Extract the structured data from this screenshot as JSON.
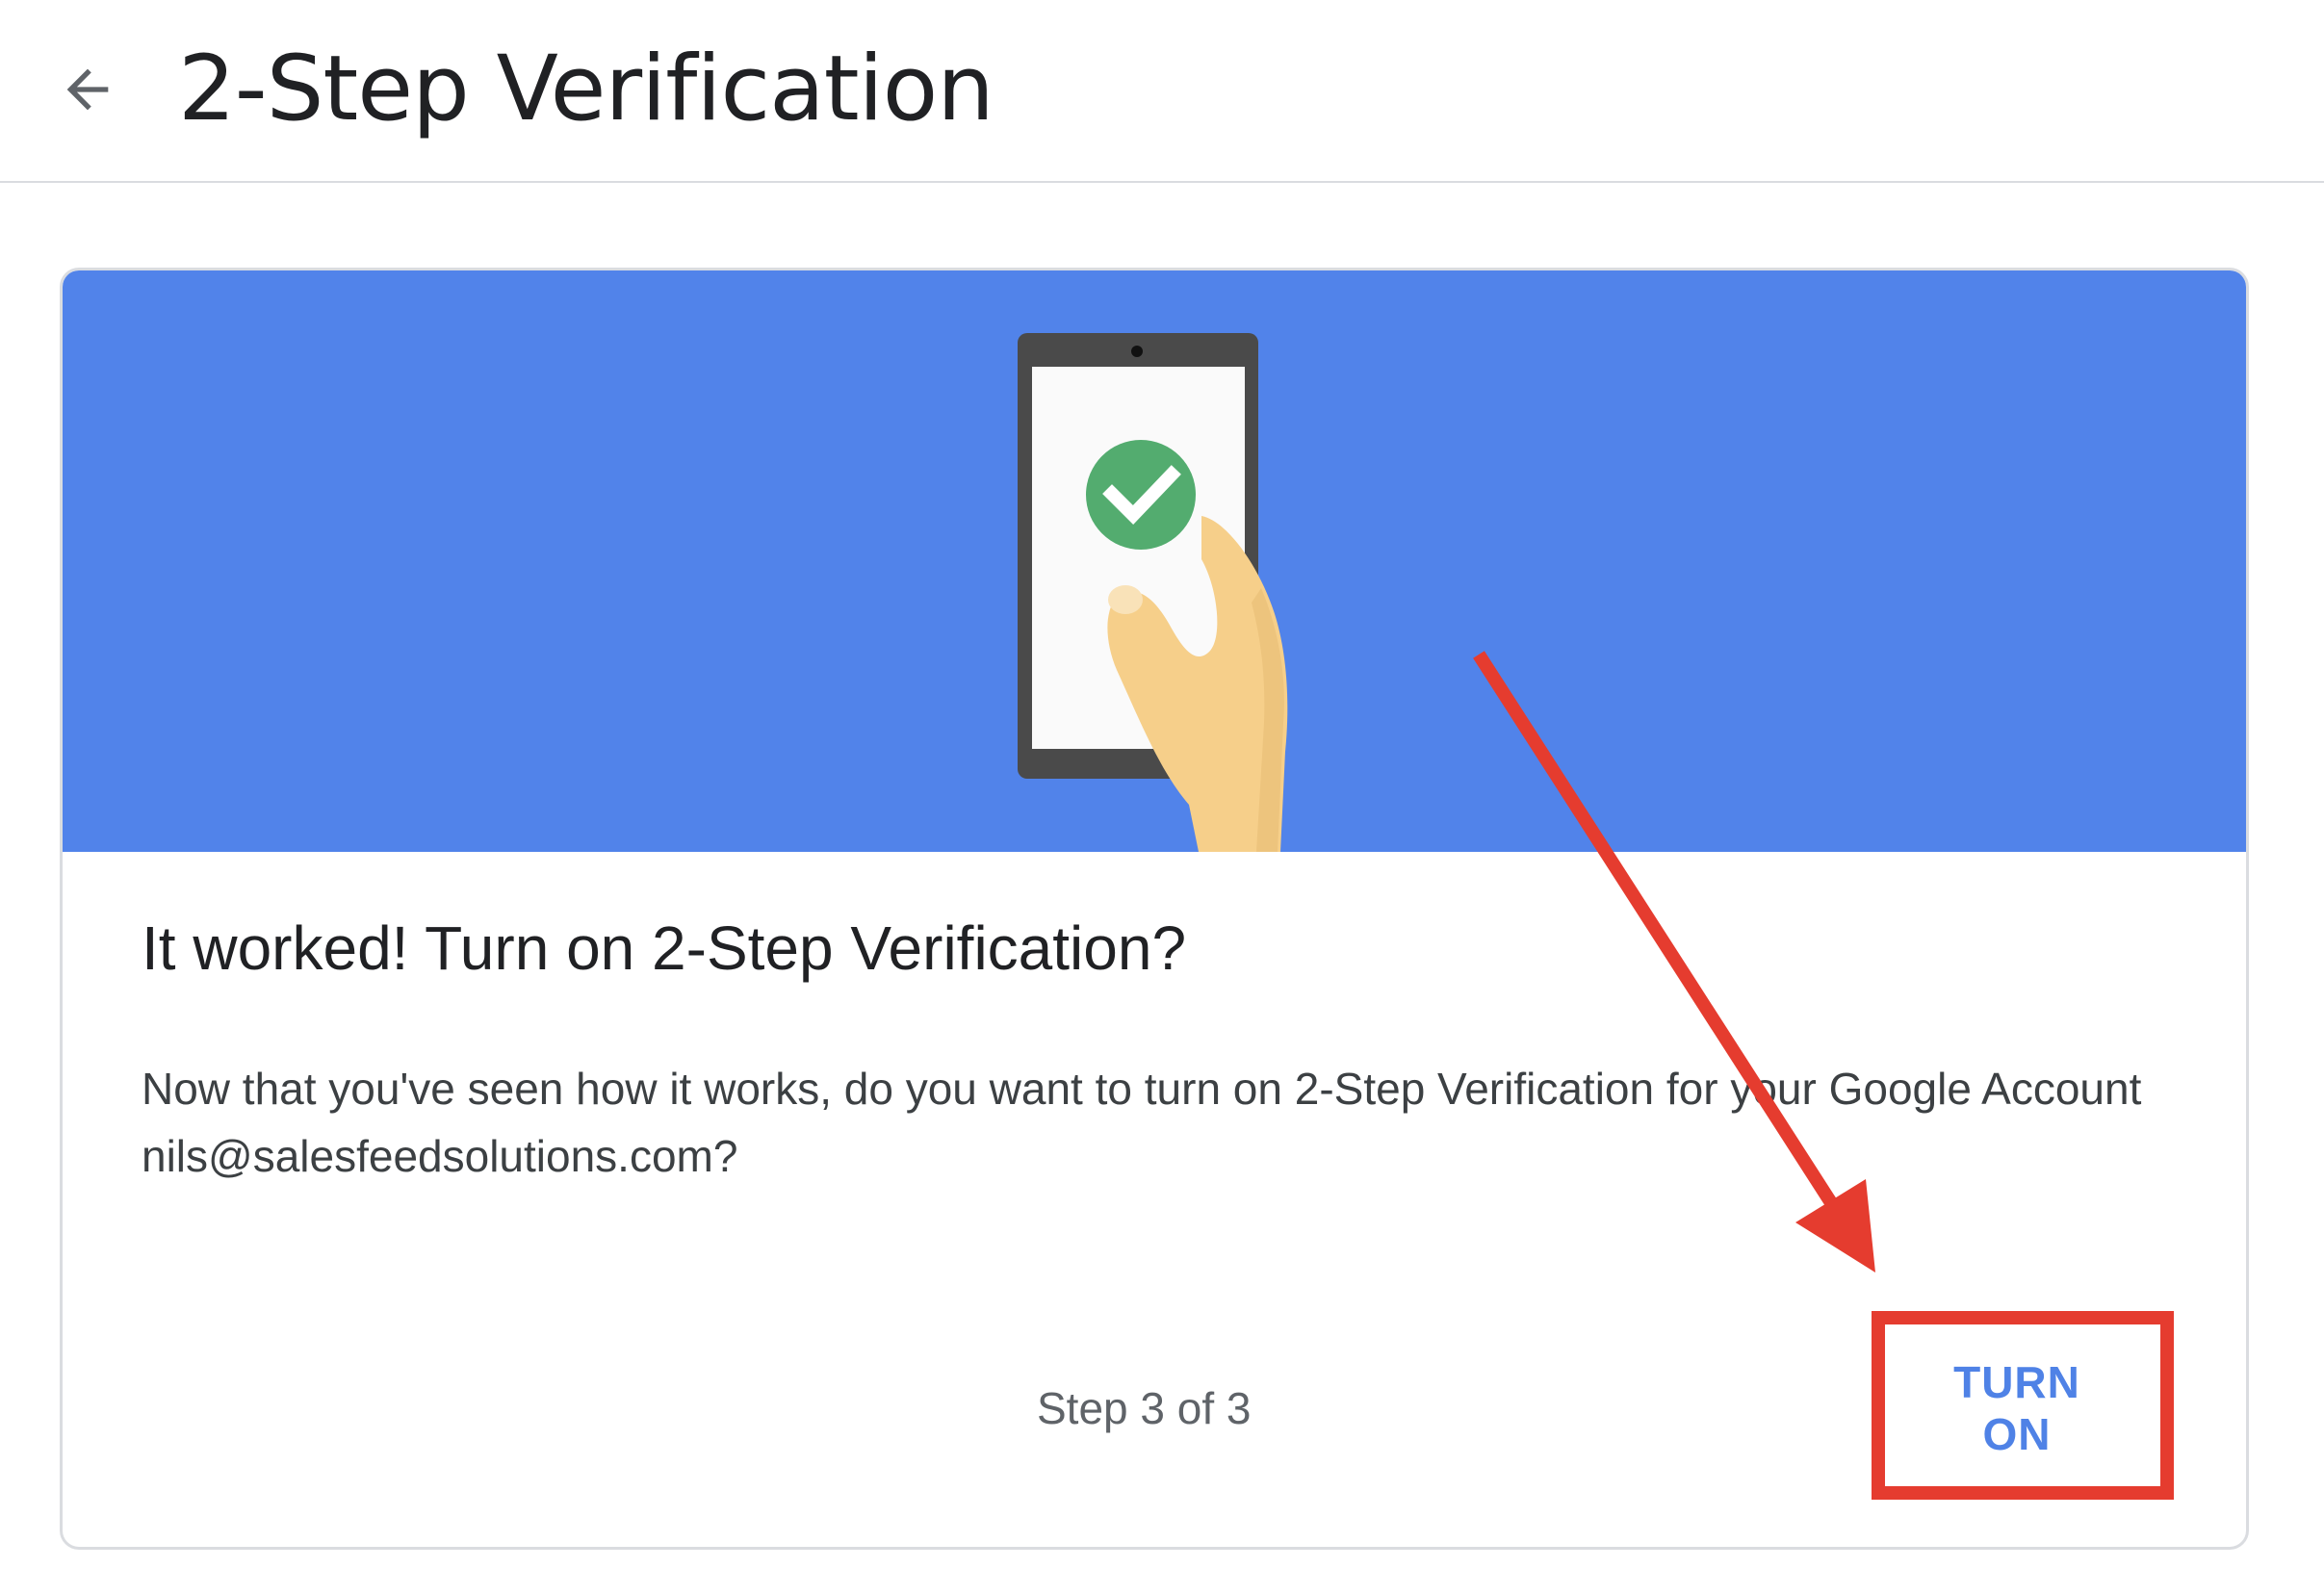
{
  "header": {
    "back_icon": "arrow-back-icon",
    "title": "2-Step Verification"
  },
  "card": {
    "illustration": {
      "description_icon": "phone-check-illustration",
      "background_color": "#5183ea",
      "check_color": "#53ac6f"
    },
    "heading": "It worked! Turn on 2-Step Verification?",
    "body": "Now that you've seen how it works, do you want to turn on 2-Step Verification for your Google Account nils@salesfeedsolutions.com?",
    "step_indicator": "Step 3 of 3",
    "turn_on_label": "TURN ON",
    "accent_color": "#4f82e6"
  },
  "annotation": {
    "color": "#e53c2f",
    "arrow_icon": "red-arrow-annotation",
    "box_icon": "red-highlight-box"
  }
}
